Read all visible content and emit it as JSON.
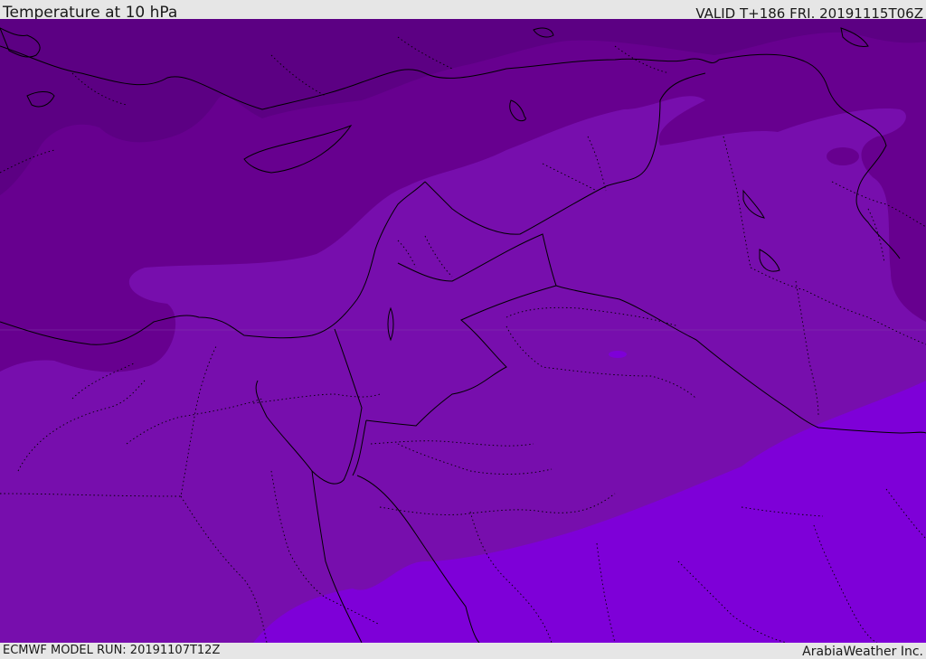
{
  "header": {
    "title": "Temperature at 10 hPa",
    "valid": "VALID T+186 FRI. 20191115T06Z"
  },
  "footer": {
    "model_run": "ECMWF MODEL RUN: 20191107T12Z",
    "credit": "ArabiaWeather Inc."
  },
  "colors": {
    "band_coldest": "#5c0083",
    "band_cold": "#67008f",
    "band_mid": "#770ead",
    "band_warm": "#7e00d8",
    "borders": "#000000",
    "bars": "#e6e6e6"
  }
}
